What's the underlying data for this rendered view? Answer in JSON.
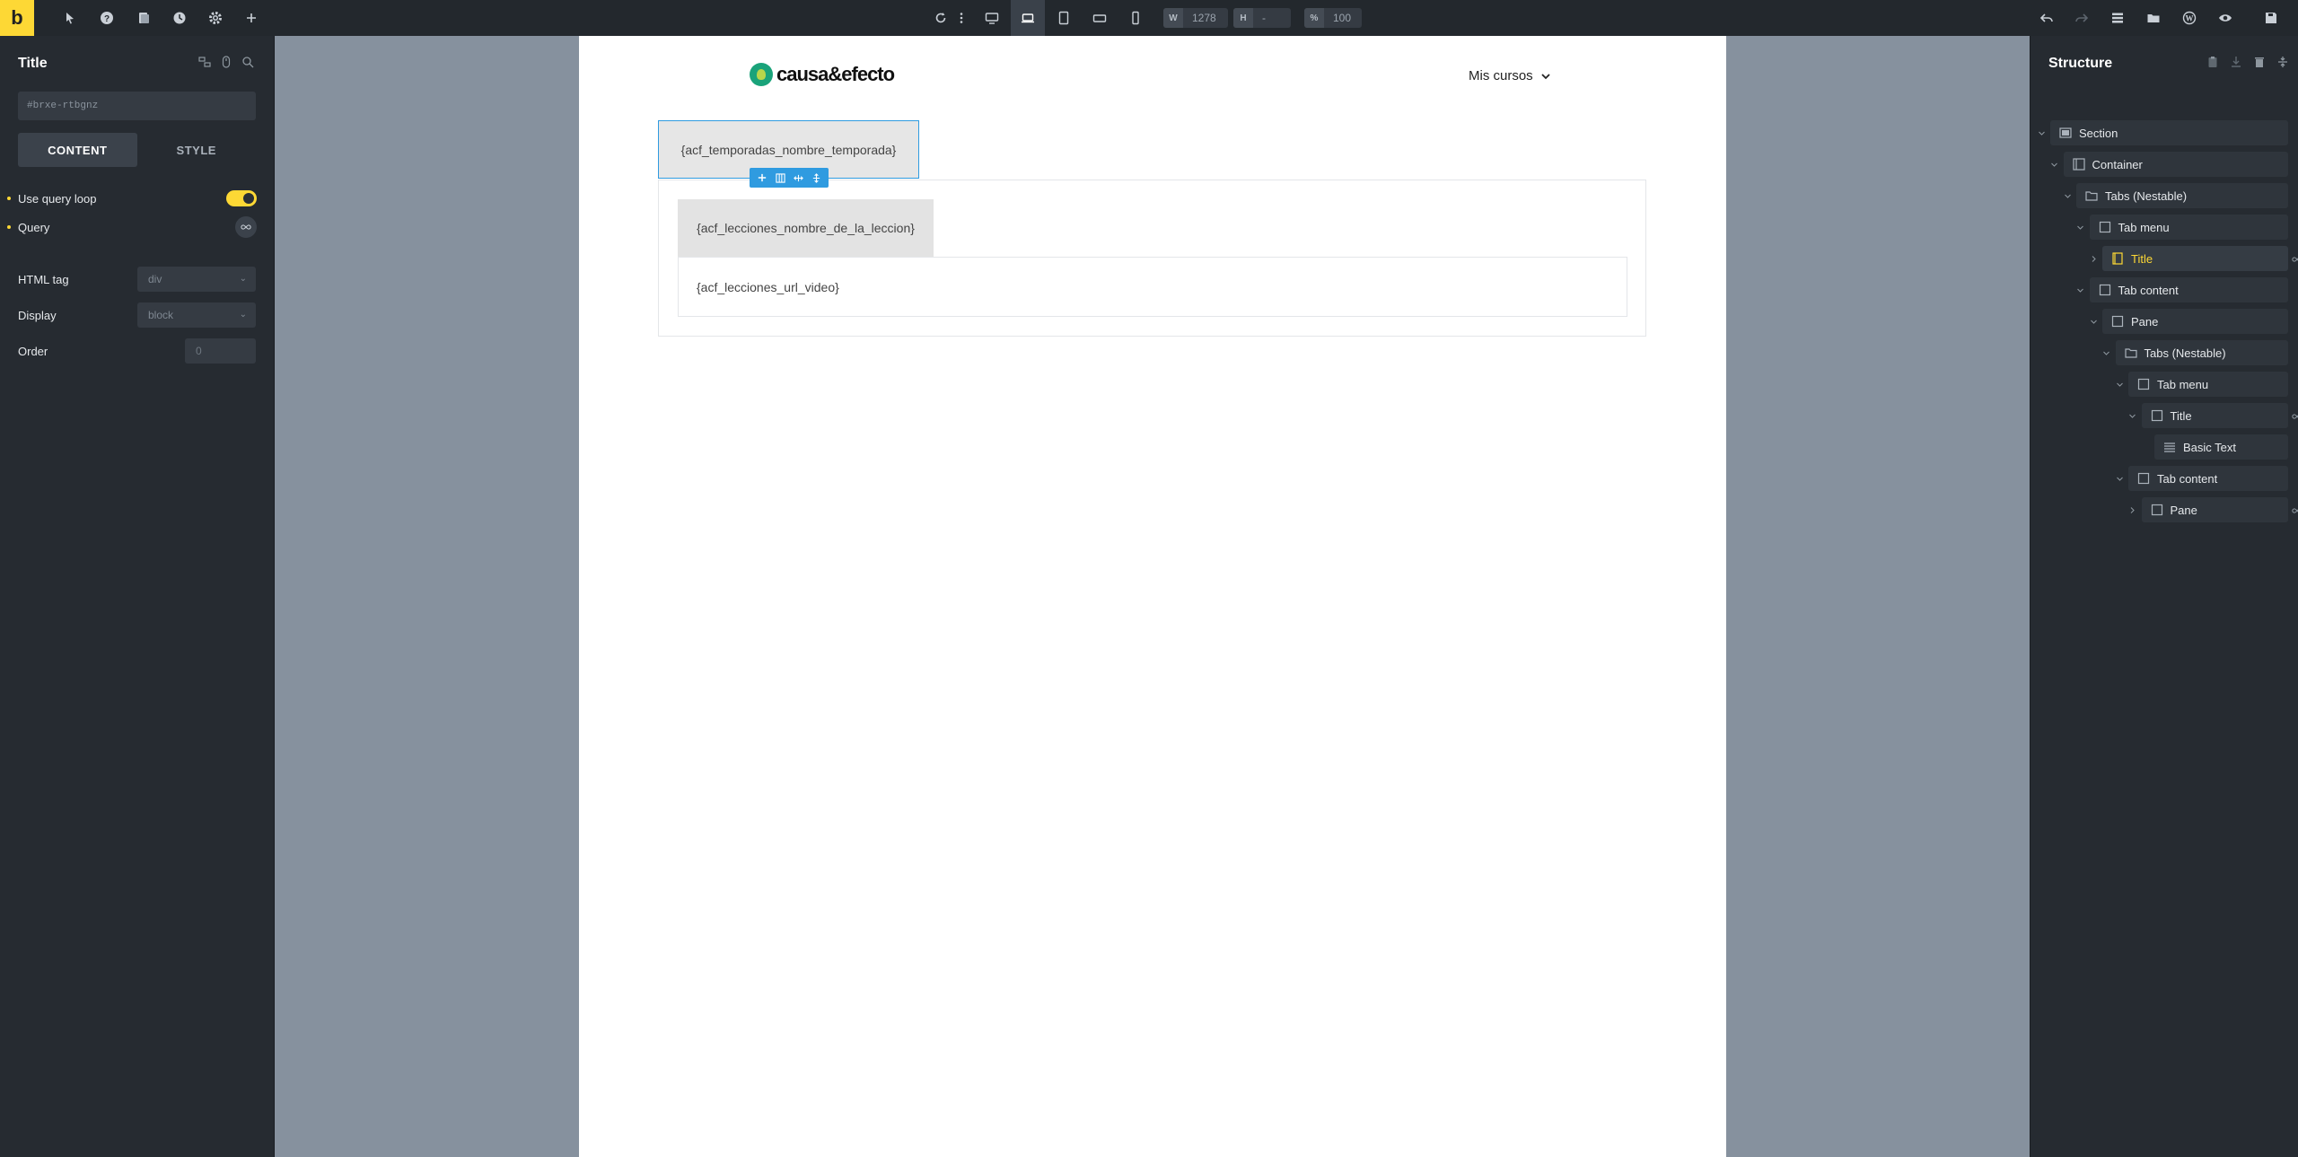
{
  "topbar": {
    "logo": "b",
    "width_label": "W",
    "width_value": "1278",
    "height_label": "H",
    "height_value": "-",
    "zoom_label": "%",
    "zoom_value": "100"
  },
  "left_panel": {
    "title": "Title",
    "element_id": "#brxe-rtbgnz",
    "tabs": [
      "CONTENT",
      "STYLE"
    ],
    "use_query_loop": "Use query loop",
    "query": "Query",
    "html_tag_label": "HTML tag",
    "html_tag_value": "div",
    "display_label": "Display",
    "display_value": "block",
    "order_label": "Order",
    "order_value": "0"
  },
  "canvas": {
    "logo_text": "causa&efecto",
    "nav_label": "Mis cursos",
    "outer_title": "{acf_temporadas_nombre_temporada}",
    "inner_title": "{acf_lecciones_nombre_de_la_leccion}",
    "inner_pane": "{acf_lecciones_url_video}"
  },
  "right_panel": {
    "title": "Structure",
    "tree": [
      {
        "label": "Section",
        "depth": 0
      },
      {
        "label": "Container",
        "depth": 1
      },
      {
        "label": "Tabs (Nestable)",
        "depth": 2
      },
      {
        "label": "Tab menu",
        "depth": 3
      },
      {
        "label": "Title",
        "depth": 4
      },
      {
        "label": "Tab content",
        "depth": 3
      },
      {
        "label": "Pane",
        "depth": 4
      },
      {
        "label": "Tabs (Nestable)",
        "depth": 5
      },
      {
        "label": "Tab menu",
        "depth": 6
      },
      {
        "label": "Title",
        "depth": 7
      },
      {
        "label": "Basic Text",
        "depth": 8
      },
      {
        "label": "Tab content",
        "depth": 6
      },
      {
        "label": "Pane",
        "depth": 7
      }
    ]
  },
  "colors": {
    "accent": "#fdd835",
    "selection": "#2f9be0",
    "panel_bg": "#262b31",
    "canvas_bg": "#86919e"
  }
}
